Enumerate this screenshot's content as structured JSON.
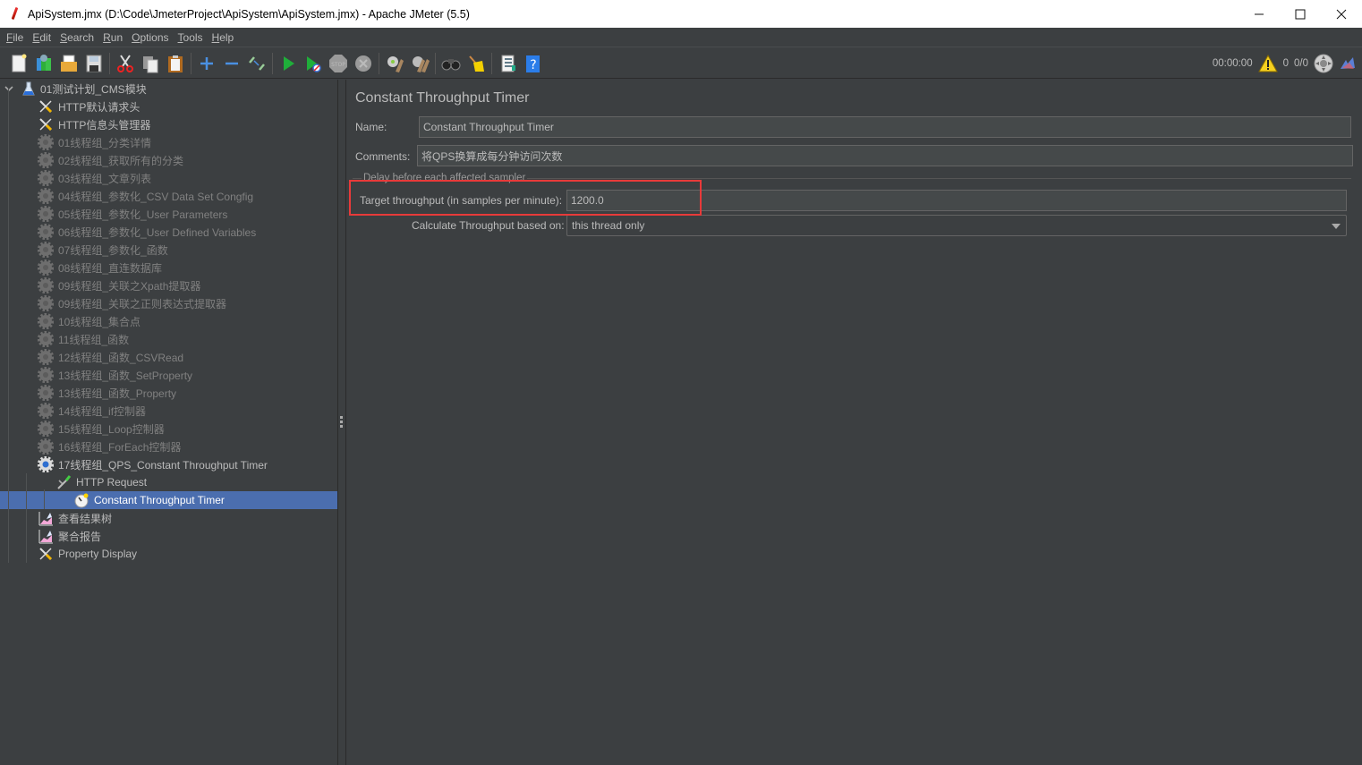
{
  "window": {
    "title": "ApiSystem.jmx (D:\\Code\\JmeterProject\\ApiSystem\\ApiSystem.jmx) - Apache JMeter (5.5)",
    "controls": {
      "minimize": "—",
      "maximize": "☐",
      "close": "✕"
    }
  },
  "menubar": [
    {
      "mn": "F",
      "rest": "ile"
    },
    {
      "mn": "E",
      "rest": "dit"
    },
    {
      "mn": "S",
      "rest": "earch"
    },
    {
      "mn": "R",
      "rest": "un"
    },
    {
      "mn": "O",
      "rest": "ptions"
    },
    {
      "mn": "T",
      "rest": "ools"
    },
    {
      "mn": "H",
      "rest": "elp"
    }
  ],
  "toolbar": {
    "buttons": [
      "new-icon",
      "templates-icon",
      "open-icon",
      "save-icon",
      "cut-icon",
      "copy-icon",
      "paste-icon",
      "expand-icon",
      "collapse-icon",
      "toggle-icon",
      "start-icon",
      "start-no-pauses-icon",
      "stop-icon",
      "shutdown-icon",
      "clear-icon",
      "clear-all-icon",
      "search-icon",
      "reset-search-icon",
      "function-helper-icon",
      "help-icon"
    ],
    "status": {
      "elapsed_time": "00:00:00",
      "warning_count": "0",
      "active_threads": "0/0"
    }
  },
  "tree": {
    "items": [
      {
        "label": "01测试计划_CMS模块",
        "icon": "test-plan-icon",
        "level": 0,
        "expander": "expanded",
        "state": "enabled"
      },
      {
        "label": "HTTP默认请求头",
        "icon": "config-tools-icon",
        "level": 1,
        "expander": "none",
        "state": "enabled"
      },
      {
        "label": "HTTP信息头管理器",
        "icon": "config-tools-icon",
        "level": 1,
        "expander": "none",
        "state": "enabled"
      },
      {
        "label": "01线程组_分类详情",
        "icon": "thread-group-icon",
        "level": 1,
        "expander": "collapsed",
        "state": "disabled"
      },
      {
        "label": "02线程组_获取所有的分类",
        "icon": "thread-group-icon",
        "level": 1,
        "expander": "collapsed",
        "state": "disabled"
      },
      {
        "label": "03线程组_文章列表",
        "icon": "thread-group-icon",
        "level": 1,
        "expander": "collapsed",
        "state": "disabled"
      },
      {
        "label": "04线程组_参数化_CSV Data Set Congfig",
        "icon": "thread-group-icon",
        "level": 1,
        "expander": "collapsed",
        "state": "disabled"
      },
      {
        "label": "05线程组_参数化_User Parameters",
        "icon": "thread-group-icon",
        "level": 1,
        "expander": "collapsed",
        "state": "disabled"
      },
      {
        "label": "06线程组_参数化_User Defined Variables",
        "icon": "thread-group-icon",
        "level": 1,
        "expander": "collapsed",
        "state": "disabled"
      },
      {
        "label": "07线程组_参数化_函数",
        "icon": "thread-group-icon",
        "level": 1,
        "expander": "collapsed",
        "state": "disabled"
      },
      {
        "label": "08线程组_直连数据库",
        "icon": "thread-group-icon",
        "level": 1,
        "expander": "collapsed",
        "state": "disabled"
      },
      {
        "label": "09线程组_关联之Xpath提取器",
        "icon": "thread-group-icon",
        "level": 1,
        "expander": "collapsed",
        "state": "disabled"
      },
      {
        "label": "09线程组_关联之正则表达式提取器",
        "icon": "thread-group-icon",
        "level": 1,
        "expander": "collapsed",
        "state": "disabled"
      },
      {
        "label": "10线程组_集合点",
        "icon": "thread-group-icon",
        "level": 1,
        "expander": "collapsed",
        "state": "disabled"
      },
      {
        "label": "11线程组_函数",
        "icon": "thread-group-icon",
        "level": 1,
        "expander": "collapsed",
        "state": "disabled"
      },
      {
        "label": "12线程组_函数_CSVRead",
        "icon": "thread-group-icon",
        "level": 1,
        "expander": "collapsed",
        "state": "disabled"
      },
      {
        "label": "13线程组_函数_SetProperty",
        "icon": "thread-group-icon",
        "level": 1,
        "expander": "collapsed",
        "state": "disabled"
      },
      {
        "label": "13线程组_函数_Property",
        "icon": "thread-group-icon",
        "level": 1,
        "expander": "collapsed",
        "state": "disabled"
      },
      {
        "label": "14线程组_if控制器",
        "icon": "thread-group-icon",
        "level": 1,
        "expander": "collapsed",
        "state": "disabled"
      },
      {
        "label": "15线程组_Loop控制器",
        "icon": "thread-group-icon",
        "level": 1,
        "expander": "collapsed",
        "state": "disabled"
      },
      {
        "label": "16线程组_ForEach控制器",
        "icon": "thread-group-icon",
        "level": 1,
        "expander": "collapsed",
        "state": "disabled"
      },
      {
        "label": "17线程组_QPS_Constant Throughput Timer",
        "icon": "thread-group-active-icon",
        "level": 1,
        "expander": "expanded",
        "state": "enabled"
      },
      {
        "label": "HTTP Request",
        "icon": "http-sampler-icon",
        "level": 2,
        "expander": "expanded",
        "state": "enabled"
      },
      {
        "label": "Constant Throughput Timer",
        "icon": "timer-icon",
        "level": 3,
        "expander": "none",
        "state": "selected"
      },
      {
        "label": "查看结果树",
        "icon": "listener-icon",
        "level": 1,
        "expander": "none",
        "state": "enabled"
      },
      {
        "label": "聚合报告",
        "icon": "listener-icon",
        "level": 1,
        "expander": "none",
        "state": "enabled"
      },
      {
        "label": "Property Display",
        "icon": "config-tools-icon",
        "level": 1,
        "expander": "none",
        "state": "enabled"
      }
    ]
  },
  "editor": {
    "title": "Constant Throughput Timer",
    "name_label": "Name:",
    "name_value": "Constant Throughput Timer",
    "comments_label": "Comments:",
    "comments_value": "将QPS换算成每分钟访问次数",
    "group_title": "Delay before each affected sampler",
    "target_label": "Target throughput (in samples per minute):",
    "target_value": "1200.0",
    "calc_label": "Calculate Throughput based on:",
    "calc_value": "this thread only"
  },
  "colors": {
    "background": "#3c3f41",
    "selection": "#4b6eaf",
    "highlight_box": "#e83a3a",
    "field_bg": "#45494a"
  }
}
